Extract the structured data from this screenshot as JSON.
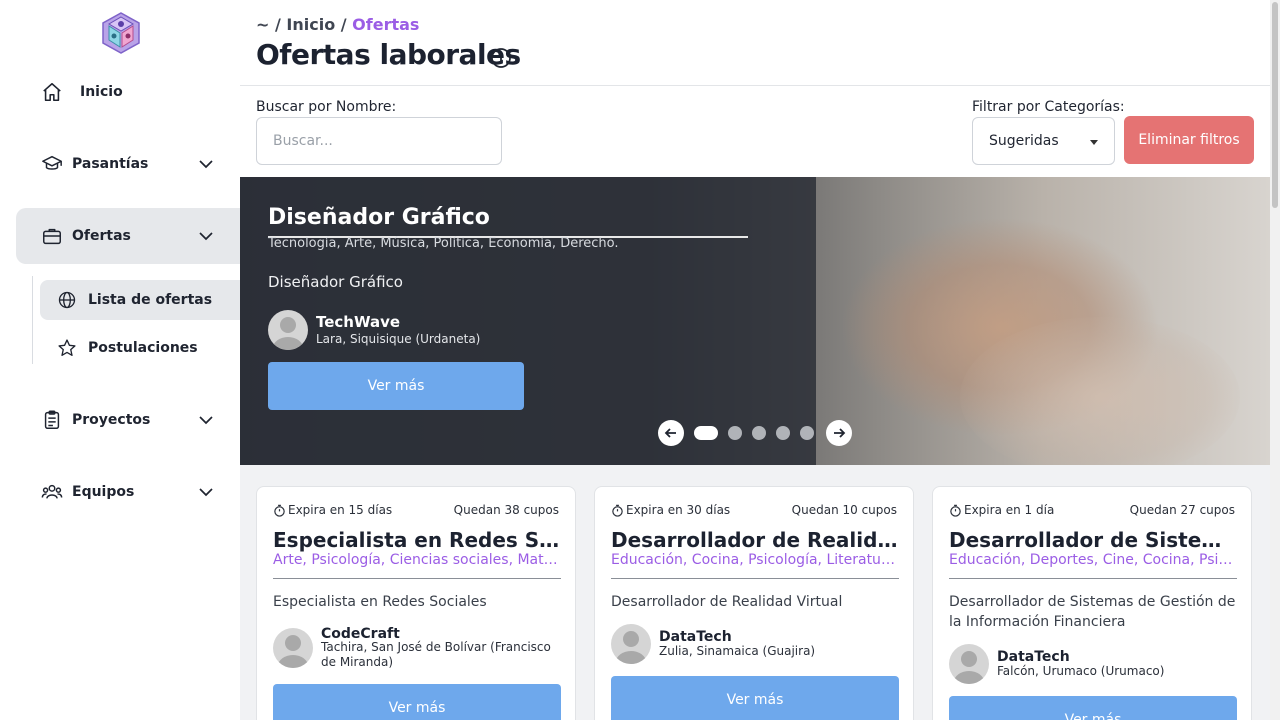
{
  "sidebar": {
    "items": [
      {
        "label": "Inicio",
        "icon": "home-icon"
      },
      {
        "label": "Pasantías",
        "icon": "graduation-cap-icon"
      },
      {
        "label": "Ofertas",
        "icon": "briefcase-icon"
      },
      {
        "label": "Proyectos",
        "icon": "clipboard-icon"
      },
      {
        "label": "Equipos",
        "icon": "users-icon"
      }
    ],
    "sub_items": [
      {
        "label": "Lista de ofertas",
        "icon": "globe-icon"
      },
      {
        "label": "Postulaciones",
        "icon": "star-icon"
      }
    ]
  },
  "header": {
    "breadcrumb_prefix": "~ / Inicio / ",
    "breadcrumb_current": "Ofertas",
    "title": "Ofertas laborales"
  },
  "filters": {
    "search_label": "Buscar por Nombre:",
    "search_placeholder": "Buscar...",
    "category_label": "Filtrar por Categorías:",
    "category_value": "Sugeridas",
    "clear_label": "Eliminar filtros"
  },
  "hero": {
    "title": "Diseñador Gráfico",
    "categories": "Tecnología, Arte, Música, Política, Economía, Derecho.",
    "description": "Diseñador Gráfico",
    "company": "TechWave",
    "location": "Lara, Siquisique (Urdaneta)",
    "button": "Ver más",
    "dots_total": 5,
    "active_dot": 1
  },
  "cards": [
    {
      "expire": "Expira en 15 días",
      "slots": "Quedan 38 cupos",
      "title": "Especialista en Redes Sociales",
      "categories": "Arte, Psicología, Ciencias sociales, Matemáticas",
      "description": "Especialista en Redes Sociales",
      "company": "CodeCraft",
      "location": "Tachira, San José de Bolívar (Francisco de Miranda)",
      "button": "Ver más"
    },
    {
      "expire": "Expira en 30 días",
      "slots": "Quedan 10 cupos",
      "title": "Desarrollador de Realidad Virtual",
      "categories": "Educación, Cocina, Psicología, Literatura, Arte",
      "description": "Desarrollador de Realidad Virtual",
      "company": "DataTech",
      "location": "Zulia, Sinamaica (Guajira)",
      "button": "Ver más"
    },
    {
      "expire": "Expira en 1 día",
      "slots": "Quedan 27 cupos",
      "title": "Desarrollador de Sistemas de Gestión",
      "categories": "Educación, Deportes, Cine, Cocina, Psicología",
      "description": "Desarrollador de Sistemas de Gestión de la Información Financiera",
      "company": "DataTech",
      "location": "Falcón, Urumaco (Urumaco)",
      "button": "Ver más"
    }
  ],
  "colors": {
    "accent": "#9b5de5",
    "primary_button": "#6ea8ec",
    "danger_button": "#e57373",
    "active_nav": "#e6e8eb"
  }
}
